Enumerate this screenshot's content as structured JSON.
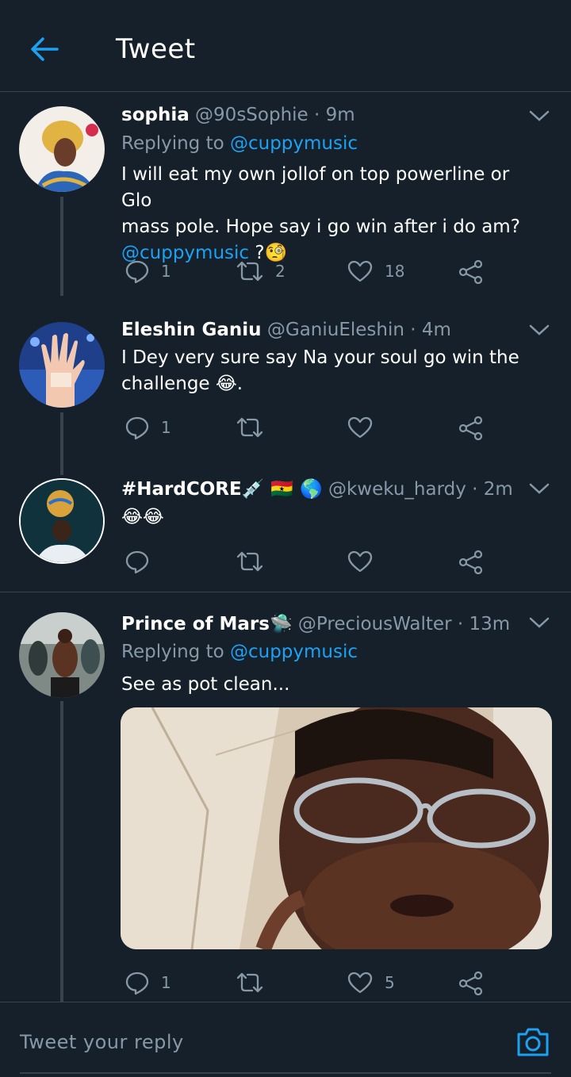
{
  "header": {
    "title": "Tweet"
  },
  "replies": [
    {
      "name": "sophia",
      "handle": "@90sSophie",
      "time": "· 9m",
      "replying_prefix": "Replying to",
      "replying_to": "@cuppymusic",
      "text_line1": "I will eat my own jollof on top powerline or Glo",
      "text_line2": "mass pole. Hope say i go win after i do am?",
      "text_mention": "@cuppymusic",
      "text_suffix": " ?🧐",
      "replies_count": "1",
      "retweets_count": "2",
      "likes_count": "18"
    },
    {
      "name": "Eleshin Ganiu",
      "handle": "@GaniuEleshin",
      "time": "· 4m",
      "text_line1": "I Dey very sure say Na your soul go win the",
      "text_line2": "challenge 😂.",
      "replies_count": "1",
      "retweets_count": "",
      "likes_count": ""
    },
    {
      "name": "#HardCORE💉 🇬🇭 🌎",
      "handle": "@kweku_hardy",
      "time": "· 2m",
      "text_line1": "😂😂",
      "replies_count": "",
      "retweets_count": "",
      "likes_count": ""
    },
    {
      "name": "Prince of Mars🛸",
      "handle": "@PreciousWalter",
      "time": "· 13m",
      "replying_prefix": "Replying to",
      "replying_to": "@cuppymusic",
      "text_line1": "See as pot clean...",
      "replies_count": "1",
      "retweets_count": "",
      "likes_count": "5"
    }
  ],
  "reply_box": {
    "placeholder": "Tweet your reply"
  },
  "colors": {
    "background": "#15202b",
    "accent": "#1da1f2",
    "muted": "#8899a6",
    "divider": "#38444d"
  },
  "icons": [
    "back-arrow-icon",
    "chevron-down-icon",
    "reply-icon",
    "retweet-icon",
    "like-icon",
    "share-icon",
    "camera-icon"
  ]
}
